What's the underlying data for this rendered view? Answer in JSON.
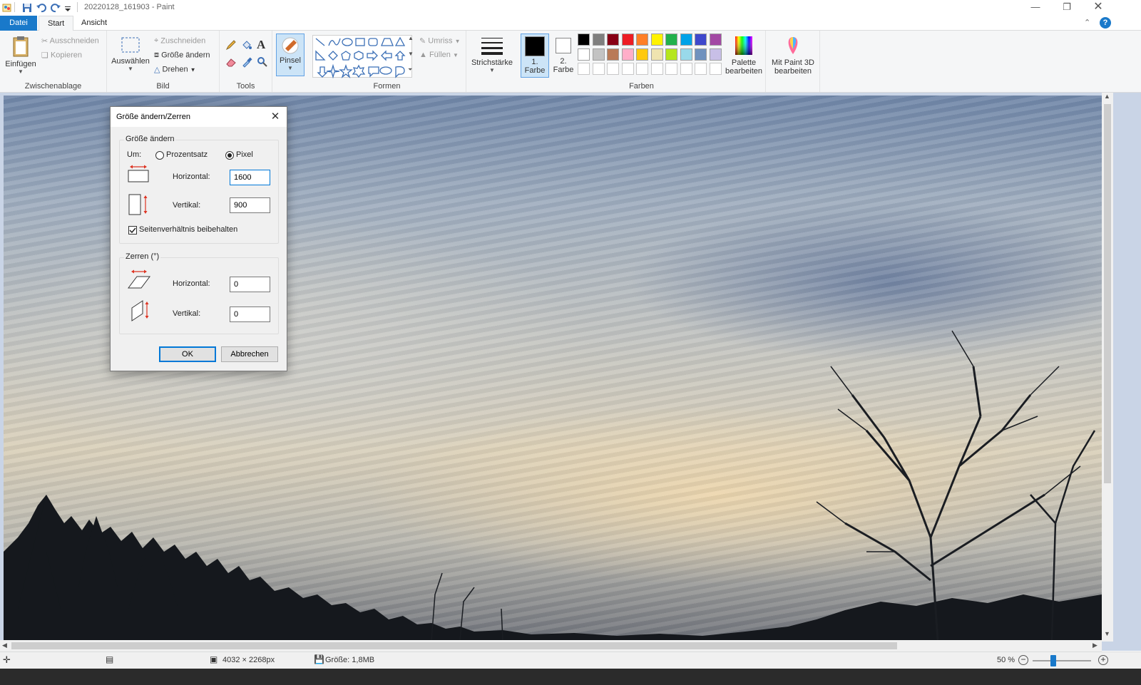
{
  "app": {
    "title": "20220128_161903 - Paint",
    "accent": "#1979ca"
  },
  "tabs": [
    {
      "label": "Datei"
    },
    {
      "label": "Start"
    },
    {
      "label": "Ansicht"
    }
  ],
  "ribbon": {
    "clipboard": {
      "paste": "Einfügen",
      "cut": "Ausschneiden",
      "copy": "Kopieren",
      "group": "Zwischenablage"
    },
    "image": {
      "select": "Auswählen",
      "crop": "Zuschneiden",
      "resize": "Größe ändern",
      "rotate": "Drehen",
      "group": "Bild"
    },
    "tools": {
      "group": "Tools"
    },
    "brush": {
      "label": "Pinsel"
    },
    "shapes": {
      "outline": "Umriss",
      "fill": "Füllen",
      "group": "Formen"
    },
    "stroke": {
      "label": "Strichstärke"
    },
    "color1": {
      "line1": "1.",
      "line2": "Farbe",
      "value": "#000000"
    },
    "color2": {
      "line1": "2.",
      "line2": "Farbe",
      "value": "#ffffff"
    },
    "colors": {
      "group": "Farben"
    },
    "edit_palette": {
      "line1": "Palette",
      "line2": "bearbeiten"
    },
    "paint3d": {
      "line1": "Mit Paint 3D",
      "line2": "bearbeiten"
    },
    "palette_row1": [
      "#000000",
      "#7f7f7f",
      "#880015",
      "#ed1c24",
      "#ff7f27",
      "#fff200",
      "#22b14c",
      "#00a2e8",
      "#3f48cc",
      "#a349a4"
    ],
    "palette_row2": [
      "#ffffff",
      "#c3c3c3",
      "#b97a57",
      "#ffaec9",
      "#ffc90e",
      "#efe4b0",
      "#b5e61d",
      "#99d9ea",
      "#7092be",
      "#c8bfe7"
    ],
    "palette_row3": [
      "#ffffff",
      "#ffffff",
      "#ffffff",
      "#ffffff",
      "#ffffff",
      "#ffffff",
      "#ffffff",
      "#ffffff",
      "#ffffff",
      "#ffffff"
    ]
  },
  "dialog": {
    "title": "Größe ändern/Zerren",
    "resize_legend": "Größe ändern",
    "by_label": "Um:",
    "percent_label": "Prozentsatz",
    "pixel_label": "Pixel",
    "horizontal_label": "Horizontal:",
    "vertical_label": "Vertikal:",
    "horizontal_value": "1600",
    "vertical_value": "900",
    "aspect_label": "Seitenverhältnis beibehalten",
    "skew_legend": "Zerren (°)",
    "skew_horizontal_label": "Horizontal:",
    "skew_vertical_label": "Vertikal:",
    "skew_horizontal_value": "0",
    "skew_vertical_value": "0",
    "ok": "OK",
    "cancel": "Abbrechen"
  },
  "status": {
    "dimensions": "4032 × 2268px",
    "size": "Größe: 1,8MB",
    "zoom": "50 %",
    "zoom_level": 0.5
  }
}
